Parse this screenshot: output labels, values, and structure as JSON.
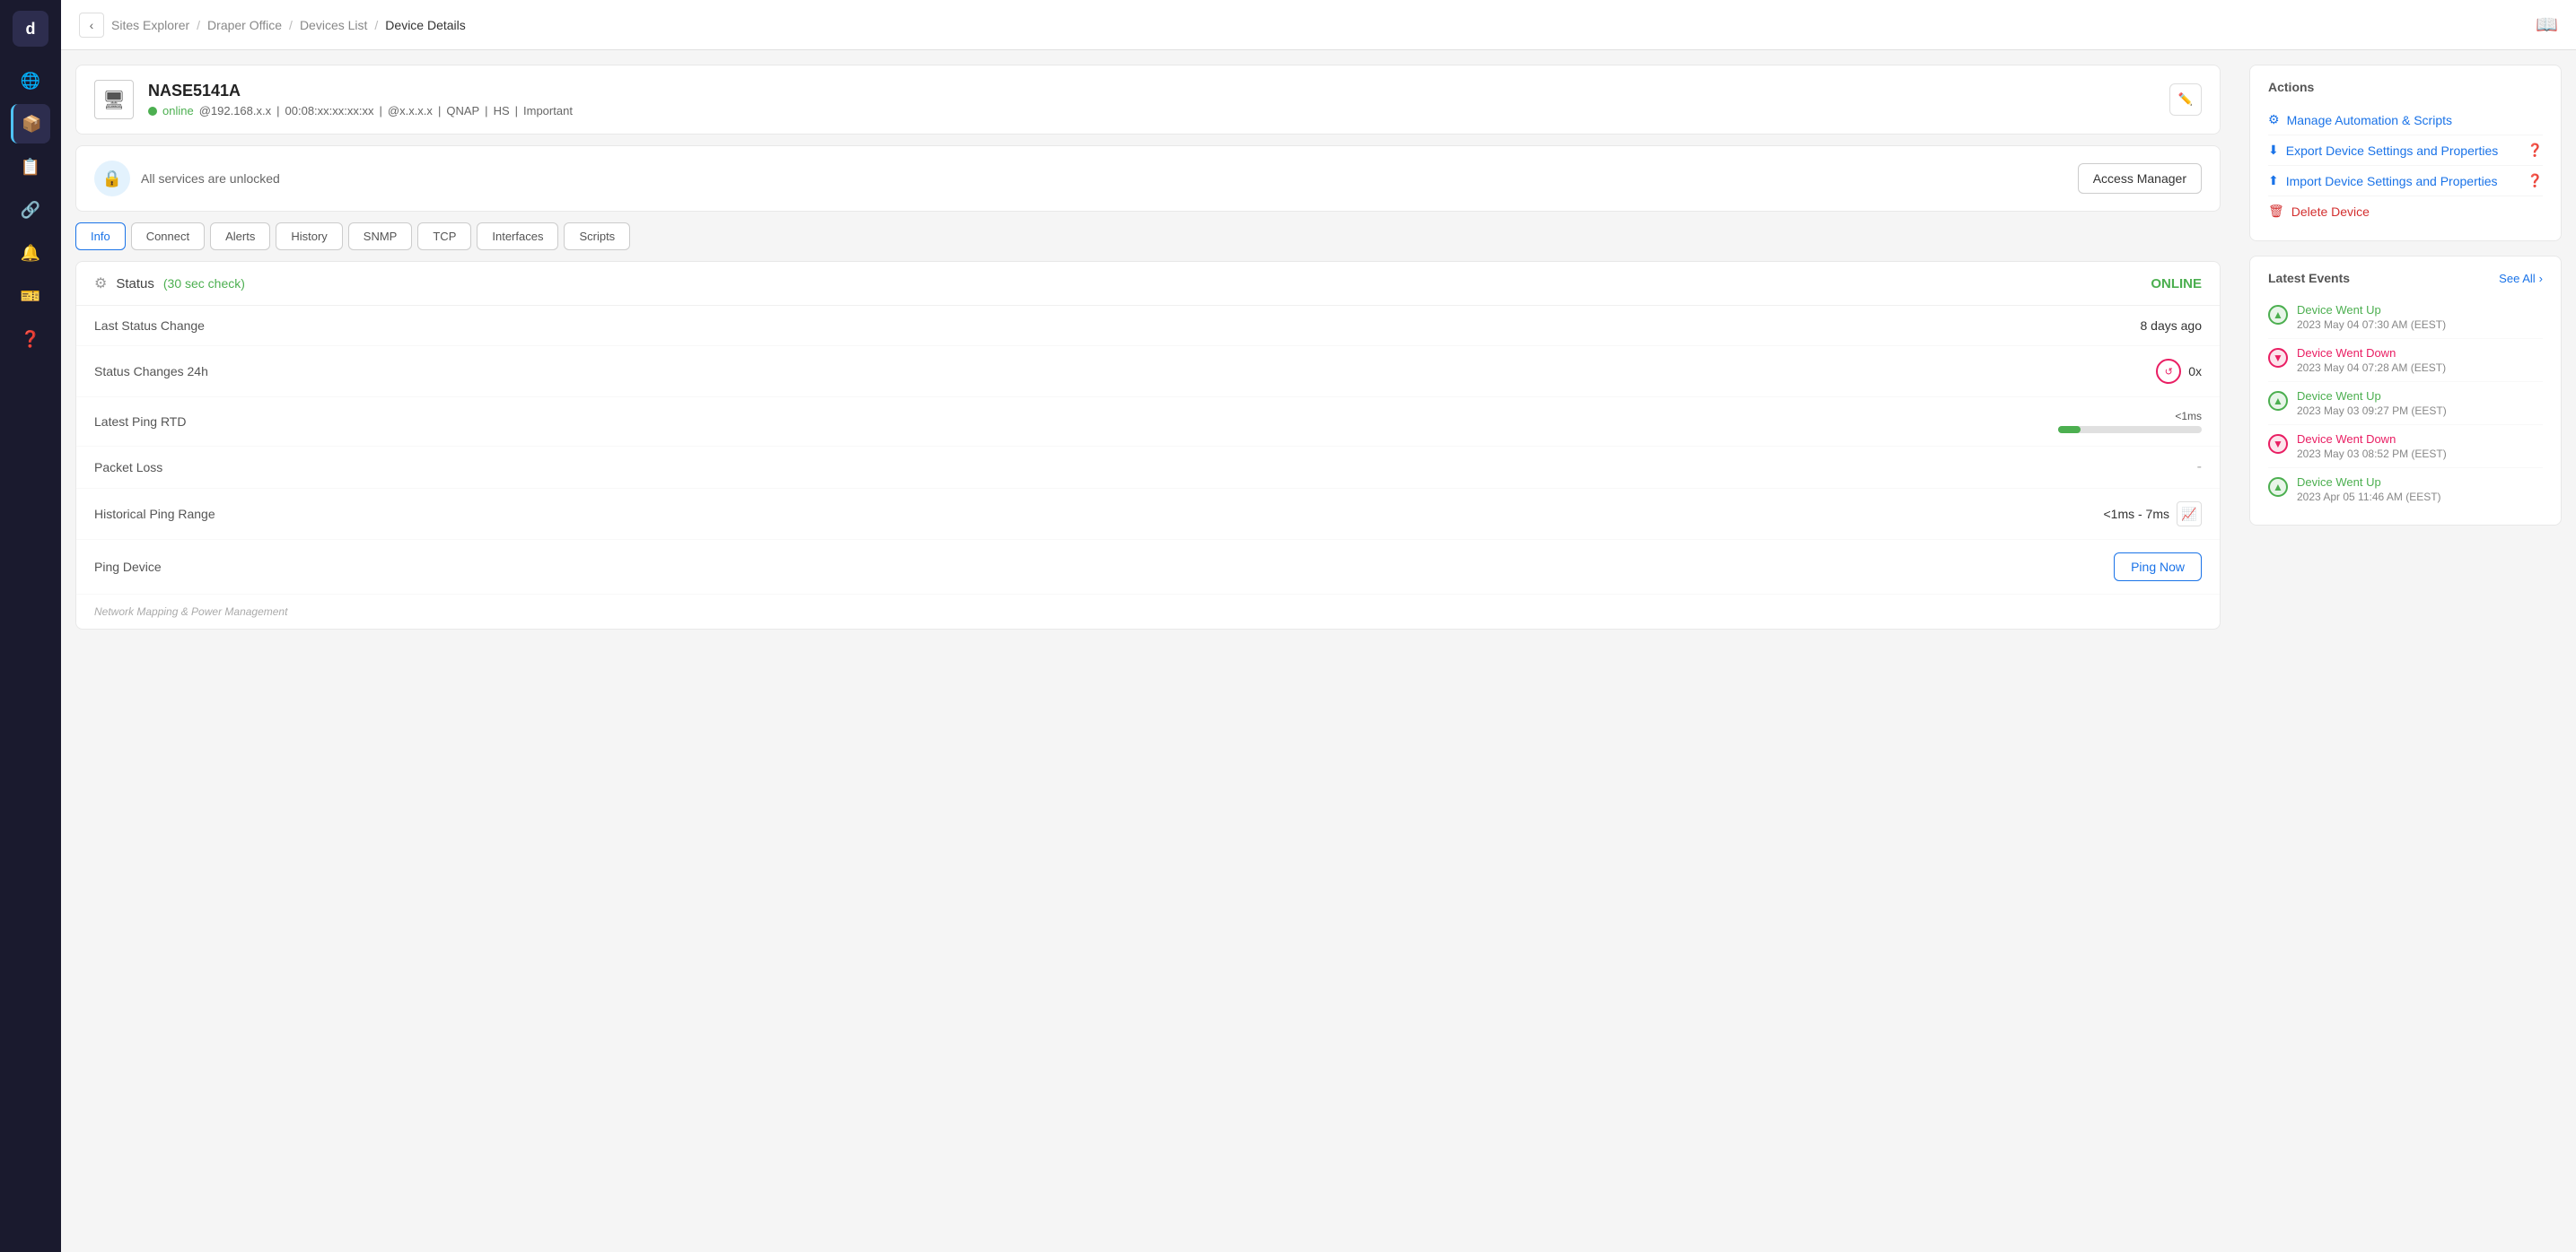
{
  "sidebar": {
    "logo": "d",
    "items": [
      {
        "id": "sites",
        "icon": "🌐",
        "label": "Sites",
        "active": false
      },
      {
        "id": "devices",
        "icon": "📦",
        "label": "Devices",
        "active": true
      },
      {
        "id": "reports",
        "icon": "📋",
        "label": "Reports",
        "active": false
      },
      {
        "id": "network",
        "icon": "🔗",
        "label": "Network",
        "active": false
      },
      {
        "id": "alerts",
        "icon": "🔔",
        "label": "Alerts",
        "active": false
      },
      {
        "id": "tickets",
        "icon": "🎫",
        "label": "Tickets",
        "active": false
      },
      {
        "id": "support",
        "icon": "❓",
        "label": "Support",
        "active": false
      }
    ]
  },
  "topbar": {
    "back_label": "‹",
    "breadcrumbs": [
      {
        "label": "Sites Explorer",
        "current": false
      },
      {
        "label": "Draper Office",
        "current": false
      },
      {
        "label": "Devices List",
        "current": false
      },
      {
        "label": "Device Details",
        "current": true
      }
    ],
    "book_icon": "📖"
  },
  "device": {
    "name": "NASE5141A",
    "status": "online",
    "ip": "@192.168.x.x",
    "mac": "00:08:xx:xx:xx:xx",
    "alt_ip": "@x.x.x.x",
    "vendor": "QNAP",
    "tier": "HS",
    "tag": "Important",
    "edit_icon": "✏️"
  },
  "access_manager": {
    "lock_icon": "🔒",
    "description": "All services are unlocked",
    "button_label": "Access Manager"
  },
  "tabs": [
    {
      "id": "info",
      "label": "Info",
      "active": true
    },
    {
      "id": "connect",
      "label": "Connect",
      "active": false
    },
    {
      "id": "alerts",
      "label": "Alerts",
      "active": false
    },
    {
      "id": "history",
      "label": "History",
      "active": false
    },
    {
      "id": "snmp",
      "label": "SNMP",
      "active": false
    },
    {
      "id": "tcp",
      "label": "TCP",
      "active": false
    },
    {
      "id": "interfaces",
      "label": "Interfaces",
      "active": false
    },
    {
      "id": "scripts",
      "label": "Scripts",
      "active": false
    }
  ],
  "status_panel": {
    "gear_icon": "⚙",
    "status_label": "Status",
    "check_interval": "(30 sec check)",
    "status_value": "ONLINE",
    "rows": [
      {
        "id": "last_status_change",
        "label": "Last Status Change",
        "value": "8 days ago",
        "type": "text"
      },
      {
        "id": "status_changes_24h",
        "label": "Status Changes 24h",
        "value": "0x",
        "type": "badge"
      },
      {
        "id": "latest_ping_rtd",
        "label": "Latest Ping RTD",
        "value": "<1ms",
        "type": "bar"
      },
      {
        "id": "packet_loss",
        "label": "Packet Loss",
        "value": "-",
        "type": "dash"
      },
      {
        "id": "historical_ping_range",
        "label": "Historical Ping Range",
        "value": "<1ms - 7ms",
        "type": "range"
      },
      {
        "id": "ping_device",
        "label": "Ping Device",
        "value": "Ping Now",
        "type": "button"
      }
    ],
    "network_footer": "Network Mapping & Power Management"
  },
  "actions": {
    "title": "Actions",
    "items": [
      {
        "id": "manage_automation",
        "icon": "⚙",
        "label": "Manage Automation & Scripts",
        "danger": false
      },
      {
        "id": "export_settings",
        "icon": "⬇",
        "label": "Export Device Settings and Properties",
        "danger": false,
        "has_help": true
      },
      {
        "id": "import_settings",
        "icon": "⬆",
        "label": "Import Device Settings and Properties",
        "danger": false,
        "has_help": true
      },
      {
        "id": "delete_device",
        "icon": "🗑",
        "label": "Delete Device",
        "danger": true
      }
    ]
  },
  "events": {
    "title": "Latest Events",
    "see_all_label": "See All",
    "items": [
      {
        "type": "up",
        "title": "Device Went Up",
        "time": "2023 May 04 07:30 AM (EEST)"
      },
      {
        "type": "down",
        "title": "Device Went Down",
        "time": "2023 May 04 07:28 AM (EEST)"
      },
      {
        "type": "up",
        "title": "Device Went Up",
        "time": "2023 May 03 09:27 PM (EEST)"
      },
      {
        "type": "down",
        "title": "Device Went Down",
        "time": "2023 May 03 08:52 PM (EEST)"
      },
      {
        "type": "up",
        "title": "Device Went Up",
        "time": "2023 Apr 05 11:46 AM (EEST)"
      }
    ]
  }
}
